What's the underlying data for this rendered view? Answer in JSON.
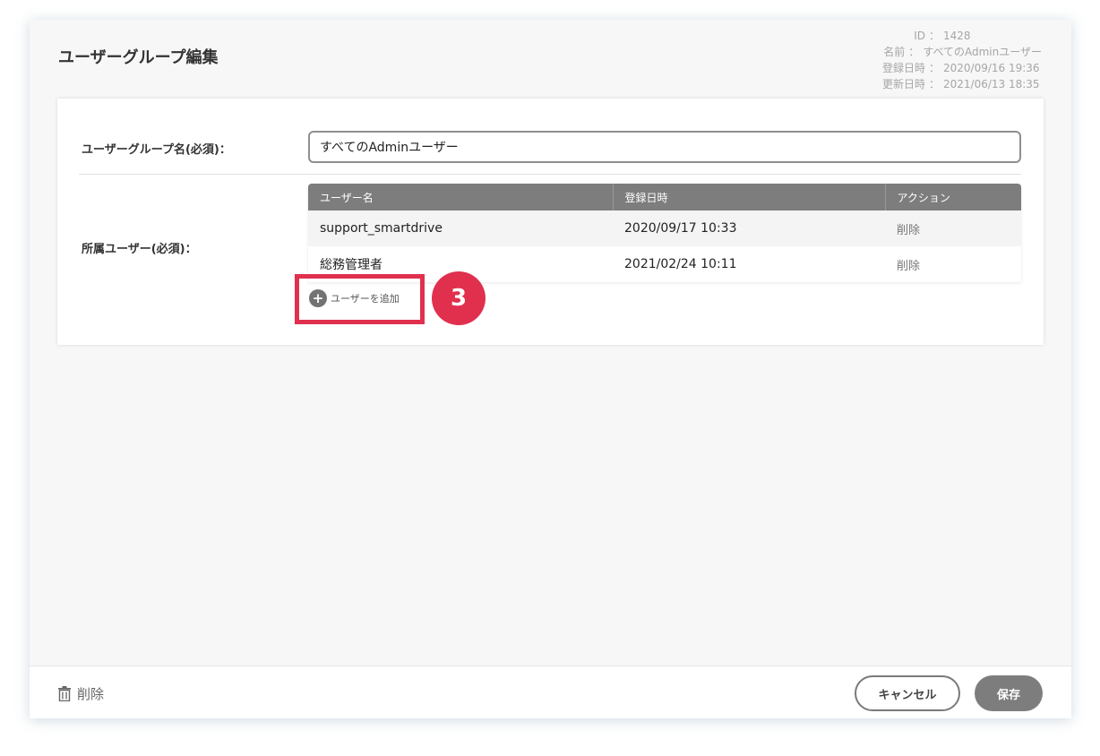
{
  "page": {
    "title": "ユーザーグループ編集"
  },
  "meta": {
    "id_label": "ID",
    "id_value": "1428",
    "name_label": "名前",
    "name_value": "すべてのAdminユーザー",
    "created_label": "登録日時",
    "created_value": "2020/09/16 19:36",
    "updated_label": "更新日時",
    "updated_value": "2021/06/13 18:35",
    "separator": "："
  },
  "form": {
    "group_name_label": "ユーザーグループ名(必須)：",
    "group_name_value": "すべてのAdminユーザー",
    "members_label": "所属ユーザー(必須)："
  },
  "table": {
    "headers": [
      "ユーザー名",
      "登録日時",
      "アクション"
    ],
    "rows": [
      {
        "name": "support_smartdrive",
        "date": "2020/09/17 10:33",
        "action": "削除"
      },
      {
        "name": "総務管理者",
        "date": "2021/02/24 10:11",
        "action": "削除"
      }
    ]
  },
  "add_user": {
    "icon": "plus-circle-icon",
    "label": "ユーザーを追加"
  },
  "annotation": {
    "step": "3",
    "color": "#e0304e"
  },
  "footer": {
    "delete_label": "削除",
    "cancel_label": "キャンセル",
    "save_label": "保存"
  }
}
